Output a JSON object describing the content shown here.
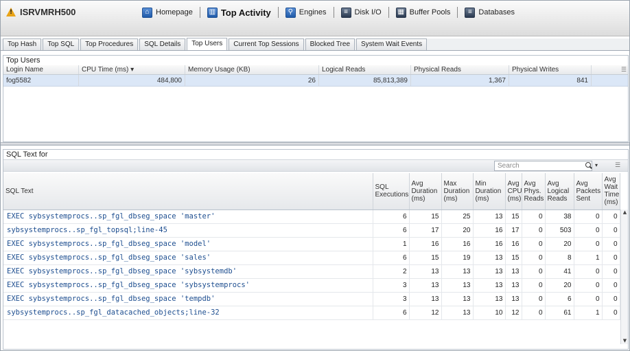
{
  "header": {
    "server_name": "ISRVMRH500",
    "nav": [
      {
        "label": "Homepage",
        "icon": "home-icon"
      },
      {
        "label": "Top Activity",
        "icon": "bar-chart-icon"
      },
      {
        "label": "Engines",
        "icon": "magnifier-icon"
      },
      {
        "label": "Disk I/O",
        "icon": "disk-icon"
      },
      {
        "label": "Buffer Pools",
        "icon": "buffer-pool-icon"
      },
      {
        "label": "Databases",
        "icon": "database-icon"
      }
    ]
  },
  "tabs": [
    "Top Hash",
    "Top SQL",
    "Top Procedures",
    "SQL Details",
    "Top Users",
    "Current Top Sessions",
    "Blocked Tree",
    "System Wait Events"
  ],
  "active_tab": "Top Users",
  "top_users": {
    "title": "Top Users",
    "columns": [
      "Login Name",
      "CPU Time (ms) ▾",
      "Memory Usage (KB)",
      "Logical Reads",
      "Physical Reads",
      "Physical Writes"
    ],
    "row": [
      "fog5582",
      "484,800",
      "26",
      "85,813,389",
      "1,367",
      "841"
    ]
  },
  "sql_panel": {
    "title": "SQL Text for",
    "search_placeholder": "Search",
    "columns": [
      "SQL Text",
      "SQL Executions",
      "Avg Duration (ms)",
      "Max Duration (ms)",
      "Min Duration (ms)",
      "Avg CPU (ms)",
      "Avg Phys. Reads",
      "Avg Logical Reads",
      "Avg Packets Sent",
      "Avg Wait Time (ms)"
    ],
    "rows": [
      [
        "EXEC sybsystemprocs..sp_fgl_dbseg_space 'master'",
        "6",
        "15",
        "25",
        "13",
        "15",
        "0",
        "38",
        "0",
        "0"
      ],
      [
        "sybsystemprocs..sp_fgl_topsql;line-45",
        "6",
        "17",
        "20",
        "16",
        "17",
        "0",
        "503",
        "0",
        "0"
      ],
      [
        "EXEC sybsystemprocs..sp_fgl_dbseg_space 'model'",
        "1",
        "16",
        "16",
        "16",
        "16",
        "0",
        "20",
        "0",
        "0"
      ],
      [
        "EXEC sybsystemprocs..sp_fgl_dbseg_space 'sales'",
        "6",
        "15",
        "19",
        "13",
        "15",
        "0",
        "8",
        "1",
        "0"
      ],
      [
        "EXEC sybsystemprocs..sp_fgl_dbseg_space 'sybsystemdb'",
        "2",
        "13",
        "13",
        "13",
        "13",
        "0",
        "41",
        "0",
        "0"
      ],
      [
        "EXEC sybsystemprocs..sp_fgl_dbseg_space 'sybsystemprocs'",
        "3",
        "13",
        "13",
        "13",
        "13",
        "0",
        "20",
        "0",
        "0"
      ],
      [
        "EXEC sybsystemprocs..sp_fgl_dbseg_space 'tempdb'",
        "3",
        "13",
        "13",
        "13",
        "13",
        "0",
        "6",
        "0",
        "0"
      ],
      [
        "sybsystemprocs..sp_fgl_datacached_objects;line-32",
        "6",
        "12",
        "13",
        "10",
        "12",
        "0",
        "61",
        "1",
        "0"
      ]
    ]
  },
  "colors": {
    "sql_text": "#1c4d8f",
    "selected_row": "#dbe7f7",
    "warning": "#e8a317"
  }
}
